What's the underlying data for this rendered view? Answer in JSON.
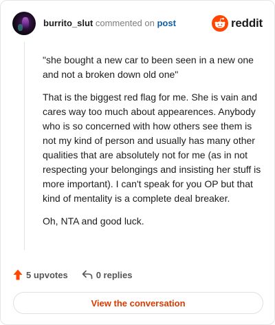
{
  "header": {
    "username": "burrito_slut",
    "action_text": "commented on",
    "post_link": "post",
    "brand_name": "reddit"
  },
  "comment": {
    "paragraphs": [
      "\"she bought a new car to been seen in a new one and not a broken down old one\"",
      "That is the biggest red flag for me. She is vain and cares way too much about appearences. Anybody who is so concerned with how others see them is not my kind of person and usually has many other qualities that are absolutely not for me (as in not respecting your belongings and insisting her stuff is more important). I can't speak for you OP but that kind of mentality is a complete deal breaker.",
      "Oh, NTA and good luck."
    ]
  },
  "actions": {
    "upvotes_label": "5 upvotes",
    "replies_label": "0 replies"
  },
  "cta": {
    "label": "View the conversation"
  },
  "colors": {
    "brand": "#ff4500",
    "link": "#0b5ea8",
    "cta_text": "#d93a00",
    "upvote": "#ff4500"
  },
  "icons": {
    "logo": "reddit-snoo-icon",
    "upvote": "arrow-up-icon",
    "reply": "reply-arrow-icon"
  }
}
